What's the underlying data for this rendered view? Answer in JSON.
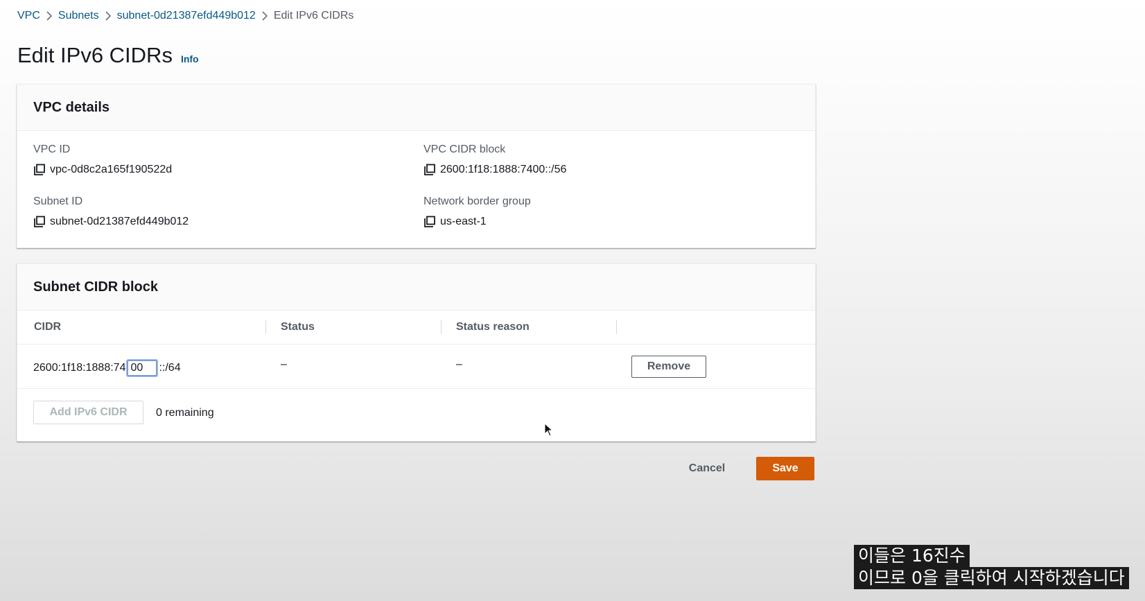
{
  "breadcrumb": {
    "items": [
      "VPC",
      "Subnets",
      "subnet-0d21387efd449b012"
    ],
    "current": "Edit IPv6 CIDRs"
  },
  "page": {
    "title": "Edit IPv6 CIDRs",
    "info": "Info"
  },
  "vpc_details": {
    "title": "VPC details",
    "vpc_id_label": "VPC ID",
    "vpc_id": "vpc-0d8c2a165f190522d",
    "vpc_cidr_label": "VPC CIDR block",
    "vpc_cidr": "2600:1f18:1888:7400::/56",
    "subnet_id_label": "Subnet ID",
    "subnet_id": "subnet-0d21387efd449b012",
    "border_group_label": "Network border group",
    "border_group": "us-east-1"
  },
  "subnet_cidr": {
    "title": "Subnet CIDR block",
    "columns": [
      "CIDR",
      "Status",
      "Status reason"
    ],
    "row": {
      "prefix": "2600:1f18:1888:74",
      "input_value": "00",
      "suffix": "::/64",
      "status": "–",
      "status_reason": "–",
      "remove_label": "Remove"
    },
    "add_label": "Add IPv6 CIDR",
    "remaining": "0 remaining"
  },
  "actions": {
    "cancel": "Cancel",
    "save": "Save"
  },
  "subtitles": {
    "line1": "이들은 16진수",
    "line2": "이므로 0을 클릭하여 시작하겠습니다"
  },
  "colors": {
    "link": "#0a5885",
    "primary": "#d45b07"
  }
}
